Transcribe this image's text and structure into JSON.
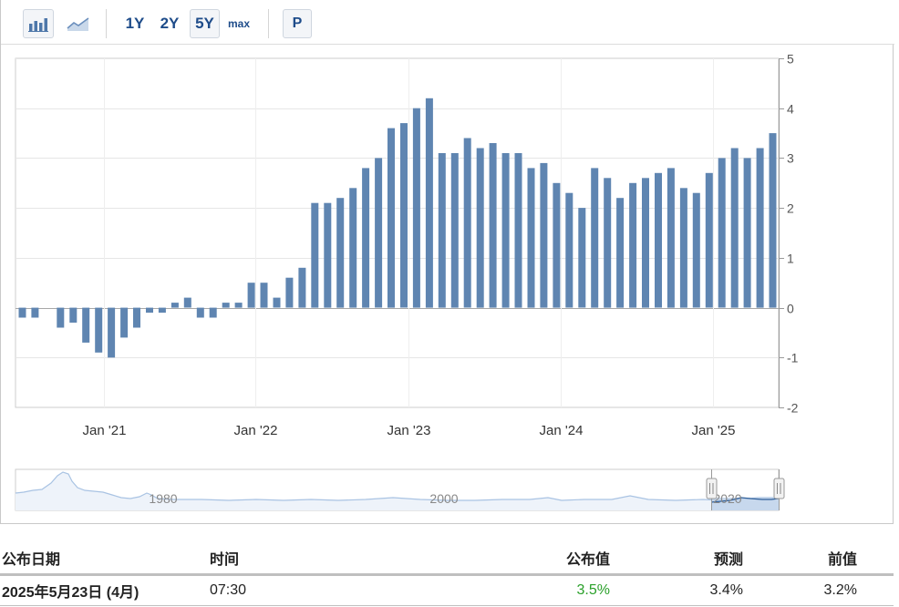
{
  "toolbar": {
    "bar_icon": "bar-chart-icon",
    "line_icon": "line-chart-icon",
    "ranges": [
      "1Y",
      "2Y",
      "5Y",
      "max"
    ],
    "active_range": "5Y",
    "print_label": "P"
  },
  "chart_data": {
    "type": "bar",
    "y_axis_position": "right",
    "ylim": [
      -2,
      5
    ],
    "yticks": [
      -2,
      -1,
      0,
      1,
      2,
      3,
      4,
      5
    ],
    "xtick_labels": [
      "Jan '21",
      "Jan '22",
      "Jan '23",
      "Jan '24",
      "Jan '25"
    ],
    "grid": true,
    "bar_color": "#5f85b1",
    "values": [
      -0.2,
      -0.2,
      null,
      -0.4,
      -0.3,
      -0.7,
      -0.9,
      -1.0,
      -0.6,
      -0.4,
      -0.1,
      -0.1,
      0.1,
      0.2,
      -0.2,
      -0.2,
      0.1,
      0.1,
      0.5,
      0.5,
      0.2,
      0.6,
      0.8,
      2.1,
      2.1,
      2.2,
      2.4,
      2.8,
      3.0,
      3.6,
      3.7,
      4.0,
      4.2,
      3.1,
      3.1,
      3.4,
      3.2,
      3.3,
      3.1,
      3.1,
      2.8,
      2.9,
      2.5,
      2.3,
      2.0,
      2.8,
      2.6,
      2.2,
      2.5,
      2.6,
      2.7,
      2.8,
      2.4,
      2.3,
      2.7,
      3.0,
      3.2,
      3.0,
      3.2,
      3.5
    ],
    "navigator": {
      "labels": [
        "1980",
        "2000",
        "2020"
      ]
    }
  },
  "table": {
    "headers": {
      "date": "公布日期",
      "time": "时间",
      "actual": "公布值",
      "forecast": "预测",
      "previous": "前值"
    },
    "rows": [
      {
        "date": "2025年5月23日 (4月)",
        "time": "07:30",
        "actual": "3.5%",
        "forecast": "3.4%",
        "previous": "3.2%"
      }
    ],
    "actual_color": "#2aa02a"
  }
}
